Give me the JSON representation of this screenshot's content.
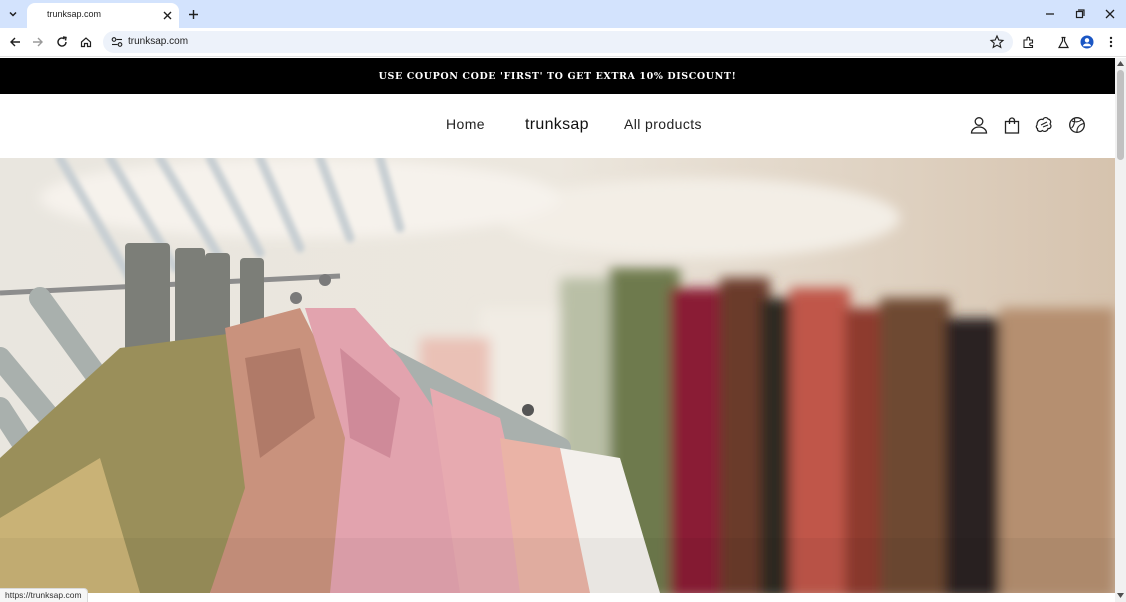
{
  "browser": {
    "tab_title": "trunksap.com",
    "url": "trunksap.com",
    "status_url": "https://trunksap.com"
  },
  "announcement": {
    "text": "USE COUPON CODE 'FIRST' TO GET EXTRA 10% DISCOUNT!"
  },
  "header": {
    "nav_home": "Home",
    "brand": "trunksap",
    "nav_all_products": "All products",
    "icons": [
      "account-icon",
      "cart-icon",
      "puzzle-icon",
      "globe-icon"
    ]
  },
  "hero": {
    "image_subject": "clothing-rack-photo"
  },
  "colors": {
    "tabstrip": "#d3e3fd",
    "announcement_bg": "#000000",
    "announcement_text": "#ffffff"
  }
}
